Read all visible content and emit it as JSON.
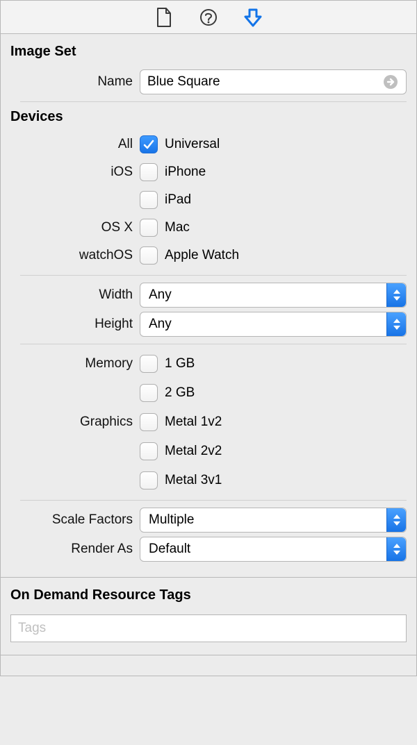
{
  "toolbar": {
    "tabs": [
      "file",
      "help",
      "downloads"
    ],
    "active": 2
  },
  "imageSet": {
    "title": "Image Set",
    "nameLabel": "Name",
    "nameValue": "Blue Square"
  },
  "devices": {
    "title": "Devices",
    "rows": [
      {
        "groupLabel": "All",
        "label": "Universal",
        "checked": true
      },
      {
        "groupLabel": "iOS",
        "label": "iPhone",
        "checked": false
      },
      {
        "groupLabel": "",
        "label": "iPad",
        "checked": false
      },
      {
        "groupLabel": "OS X",
        "label": "Mac",
        "checked": false
      },
      {
        "groupLabel": "watchOS",
        "label": "Apple Watch",
        "checked": false
      }
    ],
    "widthLabel": "Width",
    "widthValue": "Any",
    "heightLabel": "Height",
    "heightValue": "Any",
    "memoryLabel": "Memory",
    "memoryOptions": [
      {
        "label": "1 GB",
        "checked": false
      },
      {
        "label": "2 GB",
        "checked": false
      }
    ],
    "graphicsLabel": "Graphics",
    "graphicsOptions": [
      {
        "label": "Metal 1v2",
        "checked": false
      },
      {
        "label": "Metal 2v2",
        "checked": false
      },
      {
        "label": "Metal 3v1",
        "checked": false
      }
    ],
    "scaleLabel": "Scale Factors",
    "scaleValue": "Multiple",
    "renderLabel": "Render As",
    "renderValue": "Default"
  },
  "odr": {
    "title": "On Demand Resource Tags",
    "placeholder": "Tags",
    "value": ""
  }
}
